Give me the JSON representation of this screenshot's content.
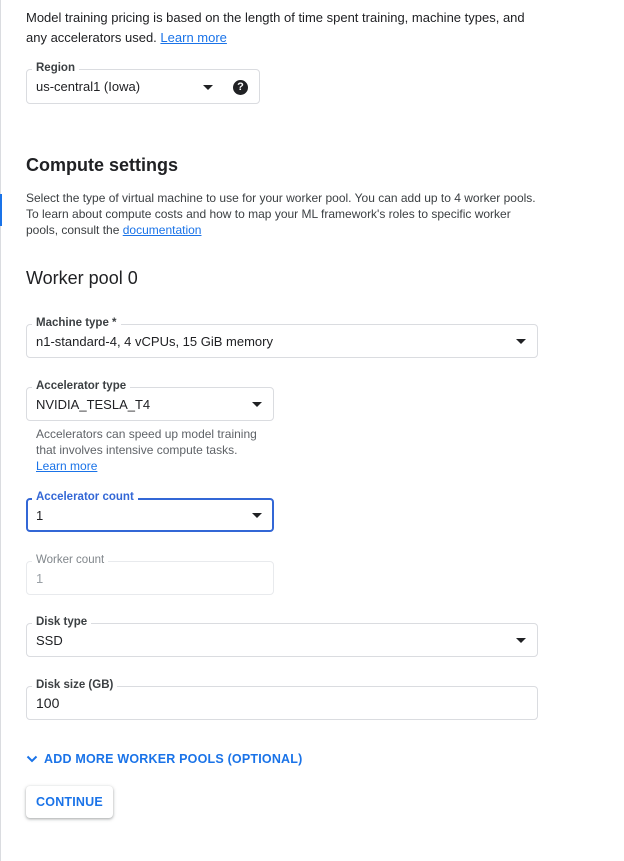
{
  "intro": {
    "text": "Model training pricing is based on the length of time spent training, machine types, and any accelerators used.",
    "learn_more": "Learn more"
  },
  "region": {
    "label": "Region",
    "value": "us-central1 (Iowa)",
    "help_icon": "help-circle-icon"
  },
  "compute": {
    "title": "Compute settings",
    "description": "Select the type of virtual machine to use for your worker pool. You can add up to 4 worker pools. To learn about compute costs and how to map your ML framework's roles to specific worker pools, consult the",
    "documentation_link": "documentation"
  },
  "worker_pool": {
    "title": "Worker pool 0",
    "machine_type": {
      "label": "Machine type *",
      "value": "n1-standard-4, 4 vCPUs, 15 GiB memory"
    },
    "accelerator_type": {
      "label": "Accelerator type",
      "value": "NVIDIA_TESLA_T4"
    },
    "accelerator_hint": {
      "text": "Accelerators can speed up model training that involves intensive compute tasks.",
      "learn_more": "Learn more"
    },
    "accelerator_count": {
      "label": "Accelerator count",
      "value": "1"
    },
    "worker_count": {
      "label": "Worker count",
      "value": "1"
    },
    "disk_type": {
      "label": "Disk type",
      "value": "SSD"
    },
    "disk_size": {
      "label": "Disk size (GB)",
      "value": "100"
    }
  },
  "add_more": {
    "label": "ADD MORE WORKER POOLS (OPTIONAL)",
    "icon": "chevron-down-icon"
  },
  "continue_label": "CONTINUE",
  "colors": {
    "accent": "#1a73e8",
    "focus": "#3367d6",
    "text": "#202124"
  }
}
